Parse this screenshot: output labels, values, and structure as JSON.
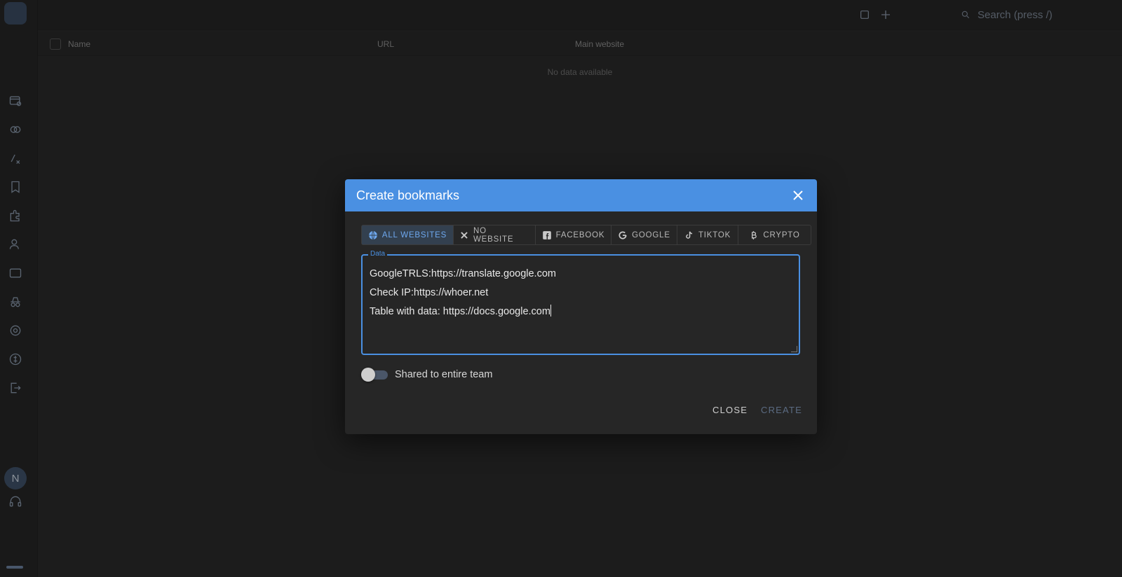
{
  "app": {
    "avatar_letter": "N",
    "search_placeholder": "Search (press /)",
    "table": {
      "columns": [
        "Name",
        "URL",
        "Main website"
      ],
      "empty_text": "No data available"
    },
    "sidebar_icons": [
      "profiles-icon",
      "proxies-icon",
      "automation-icon",
      "bookmarks-icon",
      "extensions-icon",
      "team-icon",
      "api-icon",
      "incognito-icon",
      "settings-icon",
      "billing-icon",
      "logout-icon",
      "support-icon"
    ]
  },
  "modal": {
    "title": "Create bookmarks",
    "tabs": [
      {
        "label": "ALL WEBSITES",
        "icon": "globe-icon",
        "active": true
      },
      {
        "label": "NO WEBSITE",
        "icon": "x-icon",
        "active": false
      },
      {
        "label": "FACEBOOK",
        "icon": "facebook-icon",
        "active": false
      },
      {
        "label": "GOOGLE",
        "icon": "google-icon",
        "active": false
      },
      {
        "label": "TIKTOK",
        "icon": "tiktok-icon",
        "active": false
      },
      {
        "label": "CRYPTO",
        "icon": "bitcoin-icon",
        "active": false
      }
    ],
    "data_field": {
      "label": "Data",
      "lines": [
        "GoogleTRLS:https://translate.google.com",
        "Check IP:https://whoer.net",
        "Table with data: https://docs.google.com"
      ]
    },
    "shared_toggle": {
      "label": "Shared to entire team",
      "on": false
    },
    "close_label": "CLOSE",
    "create_label": "CREATE"
  },
  "colors": {
    "accent": "#4a90e2",
    "background": "#2a2a2a",
    "surface": "#262626",
    "active_tab_text": "#6ea8ef",
    "disabled_button": "#5b6b82"
  }
}
